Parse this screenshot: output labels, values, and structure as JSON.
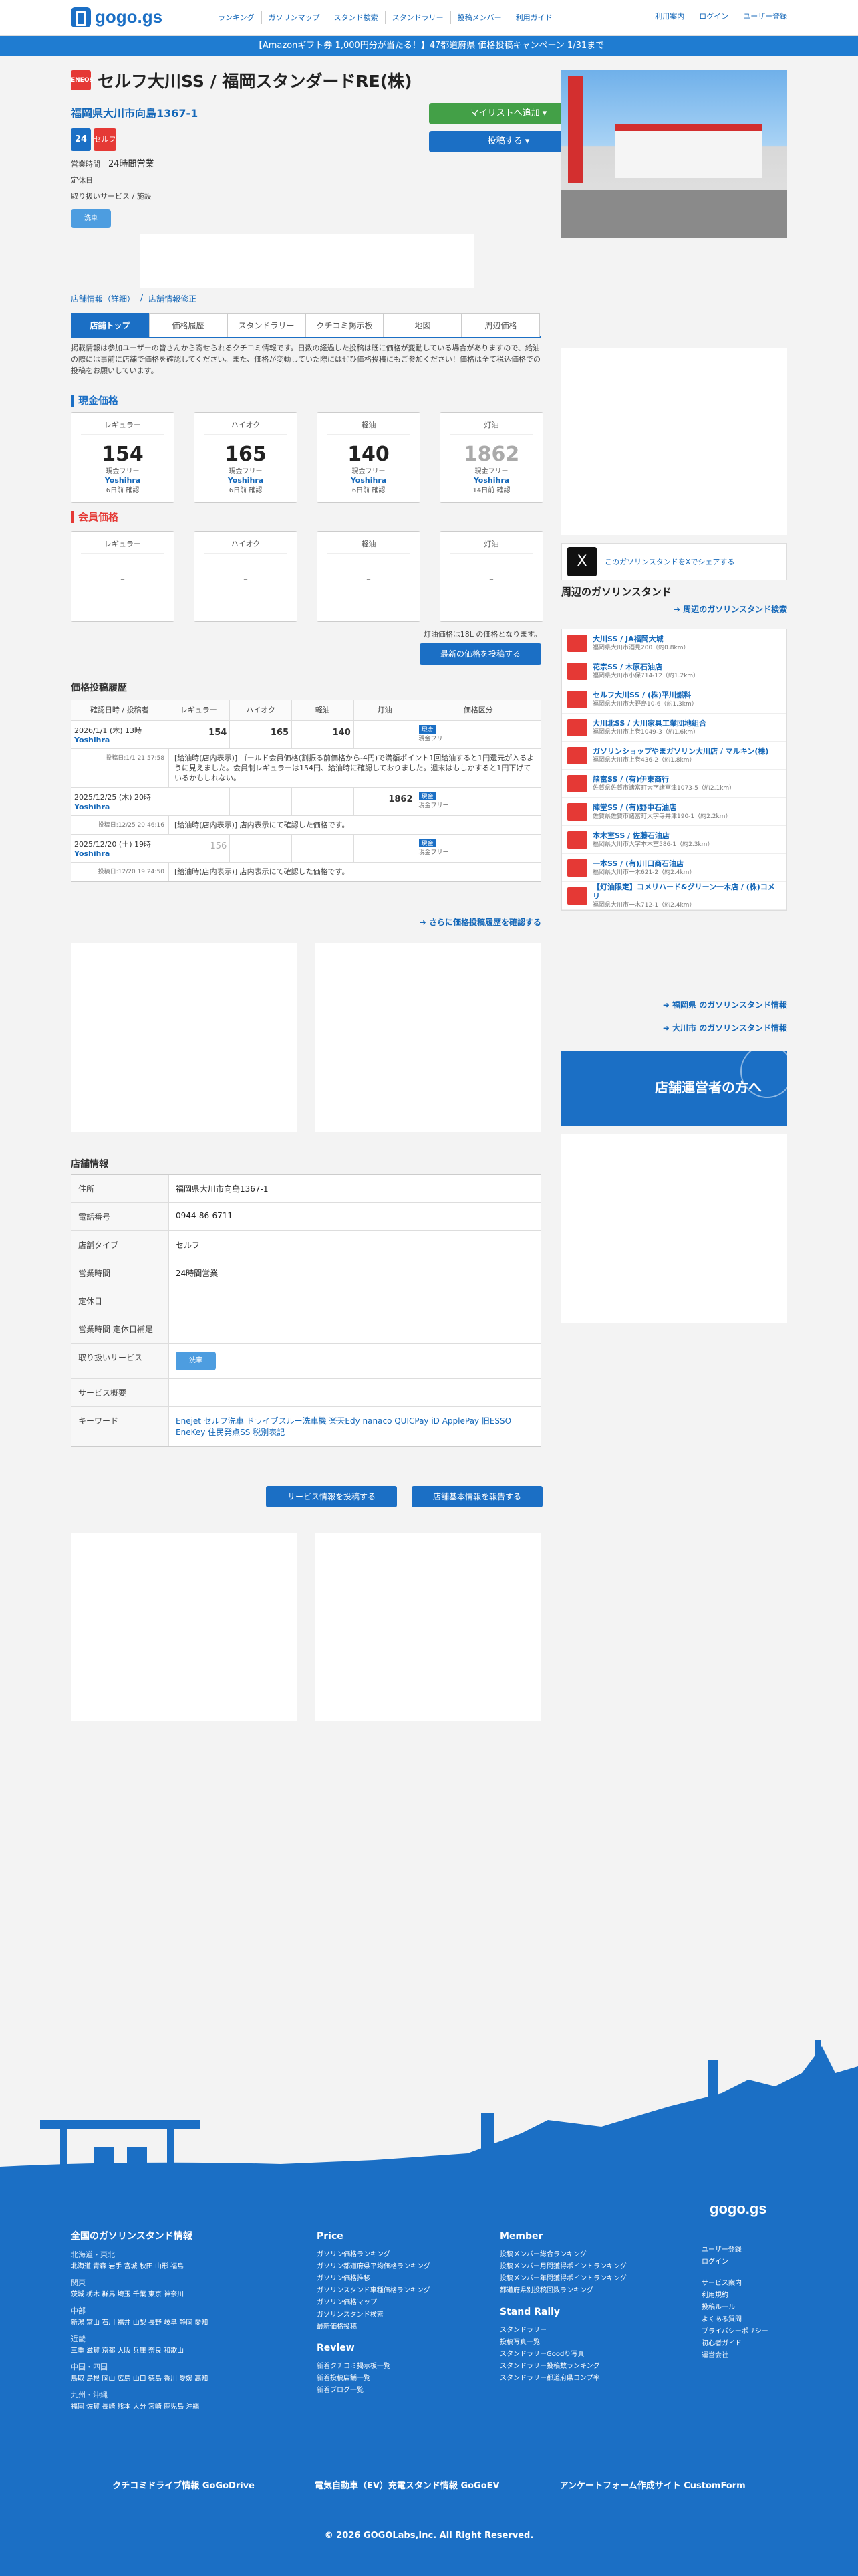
{
  "header": {
    "logo": "gogo.gs",
    "nav": [
      "ランキング",
      "ガソリンマップ",
      "スタンド検索",
      "スタンドラリー",
      "投稿メンバー",
      "利用ガイド"
    ],
    "right": [
      "利用案内",
      "ログイン",
      "ユーザー登録"
    ]
  },
  "banner": "【Amazonギフト券 1,000円分が当たる！】47都道府県 価格投稿キャンペーン 1/31まで",
  "station": {
    "name": "セルフ大川SS / 福岡スタンダードRE(株)",
    "address": "福岡県大川市向島1367-1",
    "badge_24": "24",
    "badge_self": "セルフ",
    "hours_label": "営業時間",
    "hours": "24時間営業",
    "closed_label": "定休日",
    "services_label": "取り扱いサービス / 施設",
    "svc_icon": "洗車"
  },
  "buttons": {
    "mylist": "マイリストへ追加 ▾",
    "post": "投稿する ▾"
  },
  "breadcrumb": [
    "店舗情報（詳細）",
    "店舗情報修正"
  ],
  "tabs": [
    "店舗トップ",
    "価格履歴",
    "スタンドラリー",
    "クチコミ掲示板",
    "地図",
    "周辺価格"
  ],
  "notice": "掲載情報は参加ユーザーの皆さんから寄せられるクチコミ情報です。日数の経過した投稿は既に価格が変動している場合がありますので、給油の際には事前に店舗で価格を確認してください。また、価格が変動していた際にはぜひ価格投稿にもご参加ください！価格は全て税込価格での投稿をお願いしています。",
  "cash": {
    "title": "現金価格",
    "cards": [
      {
        "label": "レギュラー",
        "price": "154",
        "type": "現金フリー",
        "user": "Yoshihra",
        "ago": "6日前 確認"
      },
      {
        "label": "ハイオク",
        "price": "165",
        "type": "現金フリー",
        "user": "Yoshihra",
        "ago": "6日前 確認"
      },
      {
        "label": "軽油",
        "price": "140",
        "type": "現金フリー",
        "user": "Yoshihra",
        "ago": "6日前 確認"
      },
      {
        "label": "灯油",
        "price": "1862",
        "type": "現金フリー",
        "user": "Yoshihra",
        "ago": "14日前 確認"
      }
    ]
  },
  "member": {
    "title": "会員価格",
    "cards": [
      {
        "label": "レギュラー",
        "price": "-"
      },
      {
        "label": "ハイオク",
        "price": "-"
      },
      {
        "label": "軽油",
        "price": "-"
      },
      {
        "label": "灯油",
        "price": "-"
      }
    ]
  },
  "kerosene_note": "灯油価格は18L の価格となります。",
  "post_latest": "最新の価格を投稿する",
  "history": {
    "title": "価格投稿履歴",
    "headers": [
      "確認日時 / 投稿者",
      "レギュラー",
      "ハイオク",
      "軽油",
      "灯油",
      "価格区分"
    ],
    "rows": [
      {
        "date": "2026/1/1 (木) 13時",
        "user": "Yoshihra",
        "reg": "154",
        "hi": "165",
        "diesel": "140",
        "ker": "",
        "tag": "現金",
        "tagtx": "現金フリー",
        "posted": "投稿日:1/1 21:57:58",
        "note": "[給油時(店内表示)] ゴールド会員価格(割振る前価格から-4円)で満額ポイント1回給油すると1円還元が入るように見えました。会員制レギュラーは154円、給油時に確認しておりました。週末はもしかすると1円下げているかもしれない。"
      },
      {
        "date": "2025/12/25 (木) 20時",
        "user": "Yoshihra",
        "reg": "",
        "hi": "",
        "diesel": "",
        "ker": "1862",
        "tag": "現金",
        "tagtx": "現金フリー",
        "posted": "投稿日:12/25 20:46:16",
        "note": "[給油時(店内表示)] 店内表示にて確認した価格です。"
      },
      {
        "date": "2025/12/20 (土) 19時",
        "user": "Yoshihra",
        "reg": "156",
        "hi": "",
        "diesel": "",
        "ker": "",
        "tag": "現金",
        "tagtx": "現金フリー",
        "posted": "投稿日:12/20 19:24:50",
        "note": "[給油時(店内表示)] 店内表示にて確認した価格です。"
      }
    ],
    "more": "さらに価格投稿履歴を確認する"
  },
  "store_info": {
    "title": "店舗情報",
    "rows": [
      {
        "k": "住所",
        "v": "福岡県大川市向島1367-1"
      },
      {
        "k": "電話番号",
        "v": "0944-86-6711"
      },
      {
        "k": "店舗タイプ",
        "v": "セルフ"
      },
      {
        "k": "営業時間",
        "v": "24時間営業"
      },
      {
        "k": "定休日",
        "v": ""
      },
      {
        "k": "営業時間 定休日補足",
        "v": ""
      },
      {
        "k": "取り扱いサービス",
        "v": ""
      },
      {
        "k": "サービス概要",
        "v": ""
      },
      {
        "k": "キーワード",
        "v": "Enejet セルフ洗車 ドライブスルー洗車機 楽天Edy nanaco QUICPay iD ApplePay 旧ESSO EneKey 住民発点SS 税別表記"
      }
    ],
    "btn_service": "サービス情報を投稿する",
    "btn_report": "店舗基本情報を報告する"
  },
  "share": "このガソリンスタンドをXでシェアする",
  "nearby": {
    "title": "周辺のガソリンスタンド",
    "search": "周辺のガソリンスタンド検索",
    "items": [
      {
        "name": "大川SS / JA福岡大城",
        "addr": "福岡県大川市酒見200（約0.8km）"
      },
      {
        "name": "花宗SS / 木原石油店",
        "addr": "福岡県大川市小保714-12（約1.2km）"
      },
      {
        "name": "セルフ大川SS / (株)平川燃料",
        "addr": "福岡県大川市大野島10-6（約1.3km）"
      },
      {
        "name": "大川北SS / 大川家具工業団地組合",
        "addr": "福岡県大川市上巻1049-3（約1.6km）"
      },
      {
        "name": "ガソリンショップやまガソリン大川店 / マルキン(株)",
        "addr": "福岡県大川市上巻436-2（約1.8km）"
      },
      {
        "name": "諸富SS / (有)伊東商行",
        "addr": "佐賀県佐賀市諸富町大字諸富津1073-5（約2.1km）"
      },
      {
        "name": "陣堂SS / (有)野中石油店",
        "addr": "佐賀県佐賀市諸富町大字寺井津190-1（約2.2km）"
      },
      {
        "name": "本木室SS / 佐藤石油店",
        "addr": "福岡県大川市大字本木室586-1（約2.3km）"
      },
      {
        "name": "一本SS / (有)川口商石油店",
        "addr": "福岡県大川市一木621-2（約2.4km）"
      },
      {
        "name": "【灯油限定】コメリハード&グリーン一木店 / (株)コメリ",
        "addr": "福岡県大川市一木712-1（約2.4km）"
      }
    ],
    "links": [
      "福岡県 のガソリンスタンド情報",
      "大川市 のガソリンスタンド情報"
    ]
  },
  "owner_banner": "店舗運営者の方へ",
  "footer": {
    "logo": "gogo.gs",
    "col1_title": "全国のガソリンスタンド情報",
    "regions": [
      {
        "name": "北海道・東北",
        "prefs": "北海道 青森 岩手 宮城 秋田 山形 福島"
      },
      {
        "name": "関東",
        "prefs": "茨城 栃木 群馬 埼玉 千葉 東京 神奈川"
      },
      {
        "name": "中部",
        "prefs": "新潟 富山 石川 福井 山梨 長野 岐阜 静岡 愛知"
      },
      {
        "name": "近畿",
        "prefs": "三重 滋賀 京都 大阪 兵庫 奈良 和歌山"
      },
      {
        "name": "中国・四国",
        "prefs": "鳥取 島根 岡山 広島 山口 徳島 香川 愛媛 高知"
      },
      {
        "name": "九州・沖縄",
        "prefs": "福岡 佐賀 長崎 熊本 大分 宮崎 鹿児島 沖縄"
      }
    ],
    "price_title": "Price",
    "price_links": [
      "ガソリン価格ランキング",
      "ガソリン都道府県平均価格ランキング",
      "ガソリン価格推移",
      "ガソリンスタンド車種価格ランキング",
      "ガソリン価格マップ",
      "ガソリンスタンド検索",
      "最新価格投稿"
    ],
    "review_title": "Review",
    "review_links": [
      "新着クチコミ掲示板一覧",
      "新着投稿店舗一覧",
      "新着ブログ一覧"
    ],
    "member_title": "Member",
    "member_links": [
      "投稿メンバー総合ランキング",
      "投稿メンバー月間獲得ポイントランキング",
      "投稿メンバー年間獲得ポイントランキング",
      "都道府県別投稿回数ランキング"
    ],
    "rally_title": "Stand Rally",
    "rally_links": [
      "スタンドラリー",
      "投稿写真一覧",
      "スタンドラリーGoodり写真",
      "スタンドラリー投稿数ランキング",
      "スタンドラリー都道府県コンプ率"
    ],
    "misc1": [
      "ユーザー登録",
      "ログイン"
    ],
    "misc2": [
      "サービス案内",
      "利用規約",
      "投稿ルール",
      "よくある質問",
      "プライバシーポリシー",
      "初心者ガイド",
      "運営会社"
    ],
    "bottom_links": [
      "クチコミドライブ情報 GoGoDrive",
      "電気自動車（EV）充電スタンド情報 GoGoEV",
      "アンケートフォーム作成サイト CustomForm"
    ],
    "copyright": "© 2026 GOGOLabs,Inc. All Right Reserved."
  }
}
